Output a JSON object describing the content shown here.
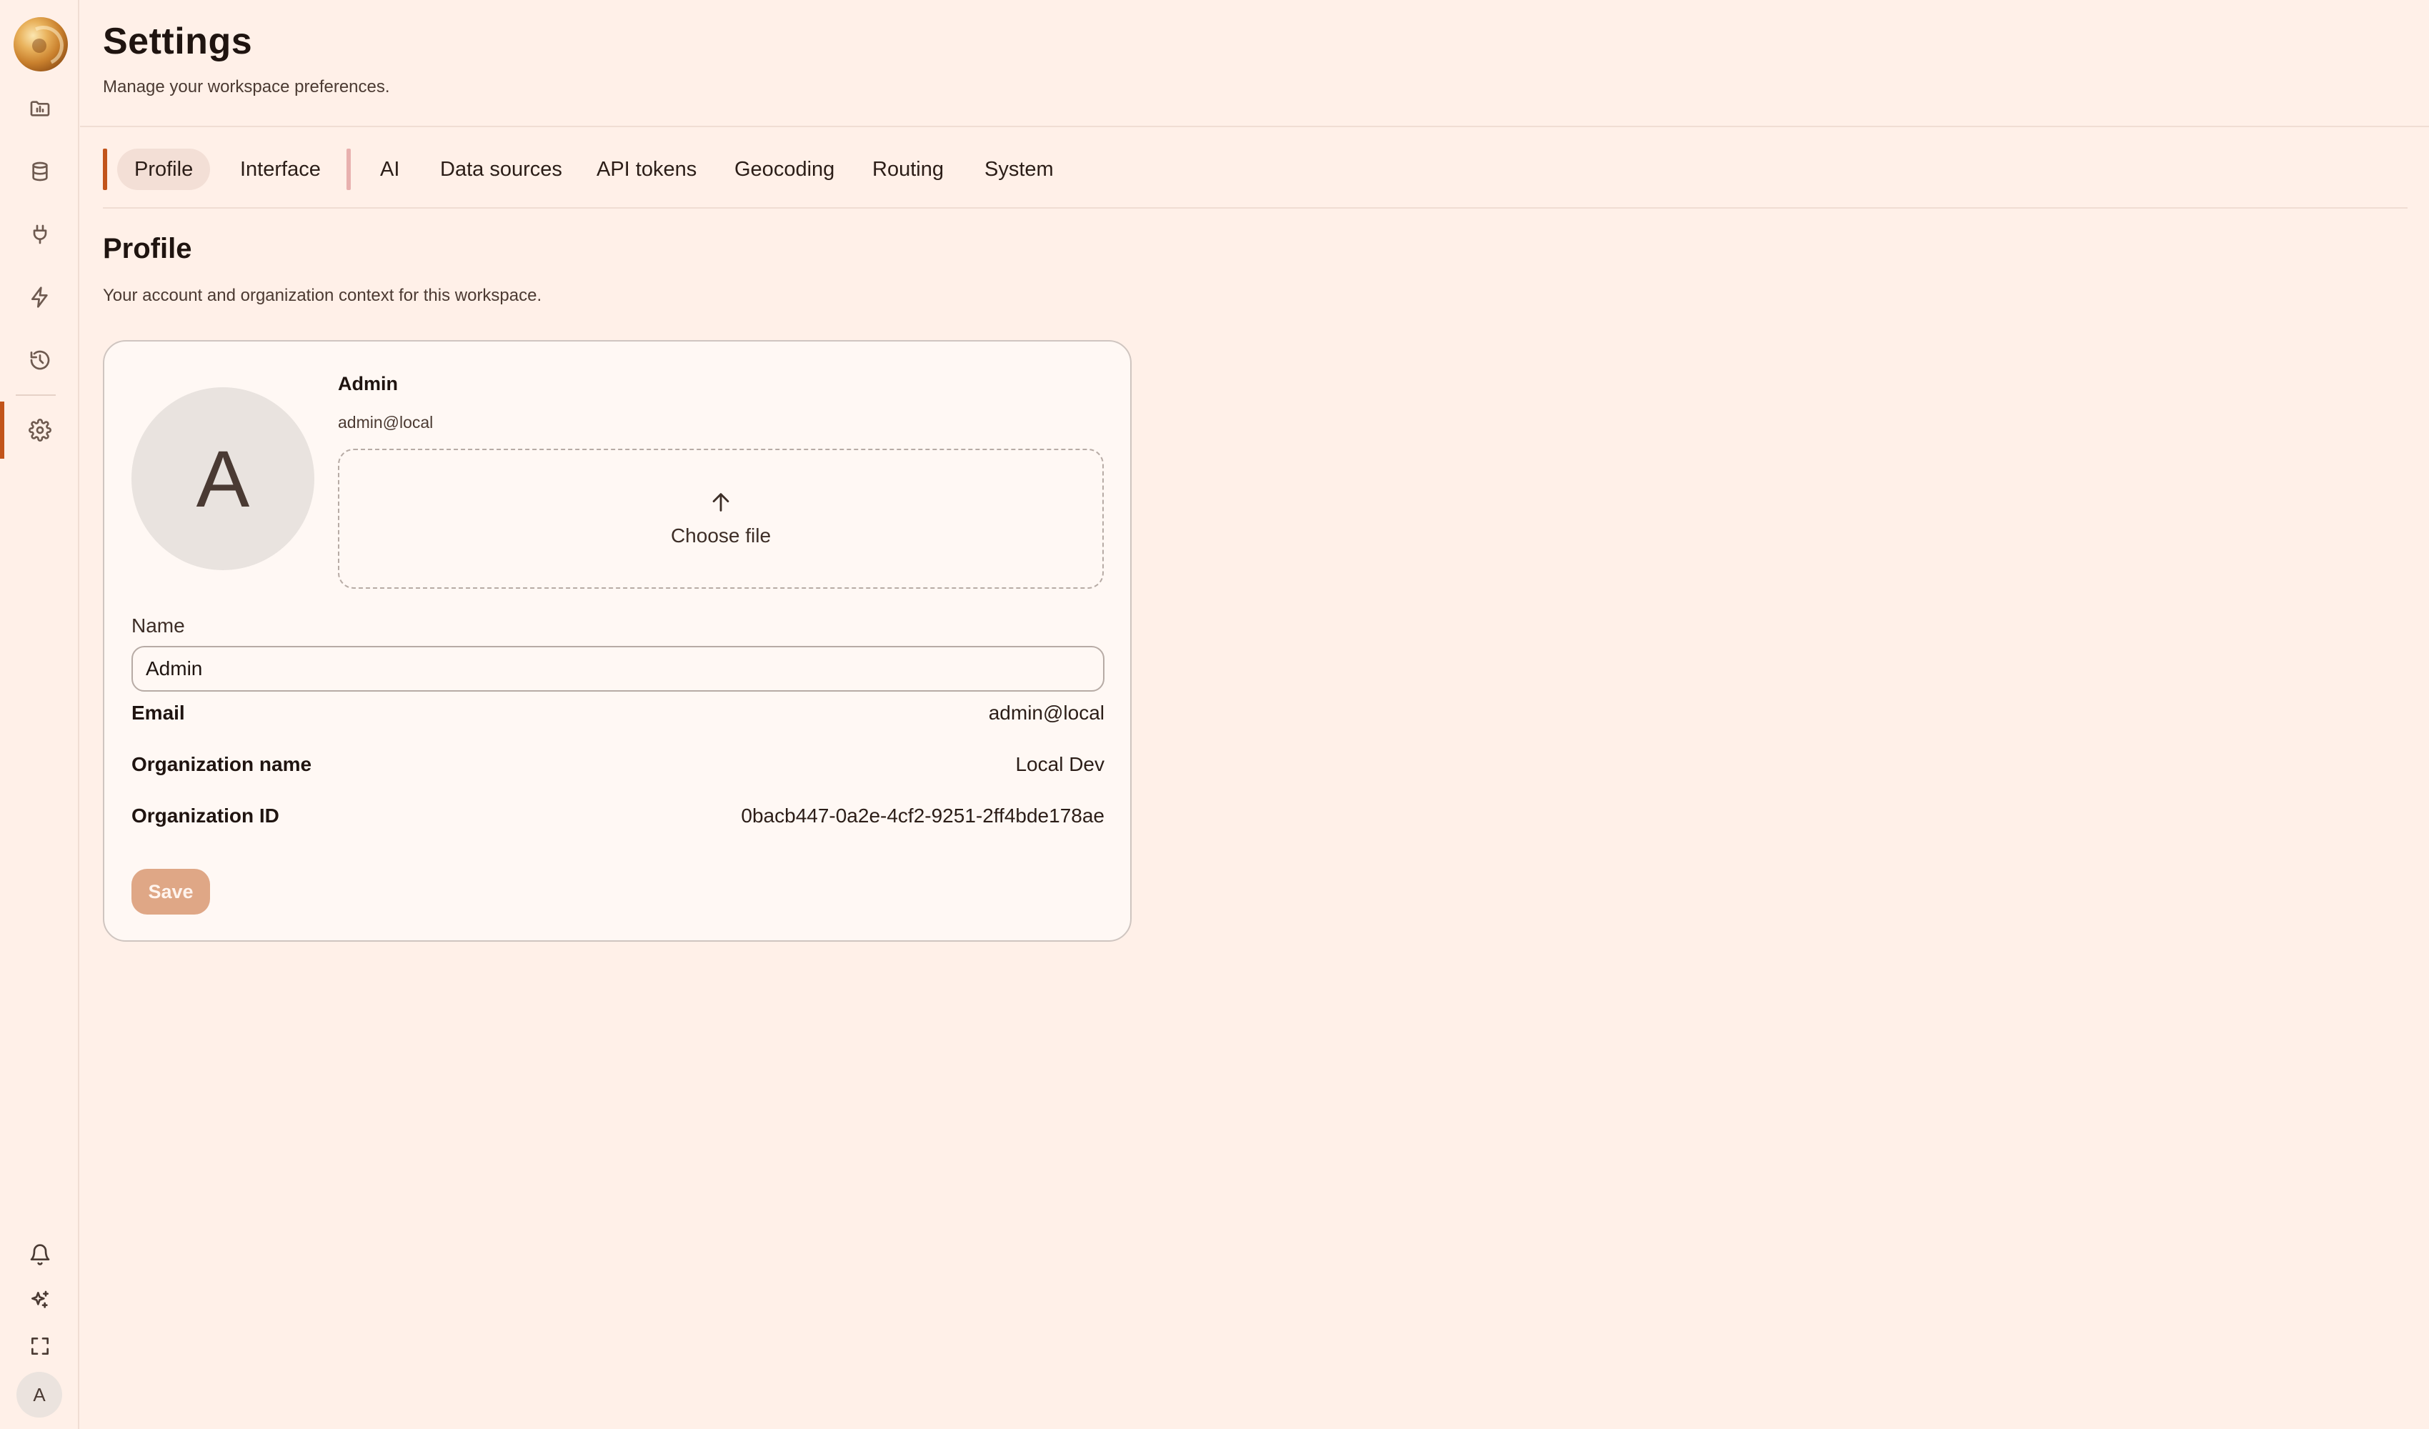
{
  "header": {
    "title": "Settings",
    "subtitle": "Manage your workspace preferences."
  },
  "sidebar": {
    "items": [
      {
        "icon": "folder-chart-icon",
        "active": false
      },
      {
        "icon": "database-icon",
        "active": false
      },
      {
        "icon": "plug-icon",
        "active": false
      },
      {
        "icon": "lightning-icon",
        "active": false
      },
      {
        "icon": "history-icon",
        "active": false
      },
      {
        "icon": "gear-icon",
        "active": true
      }
    ],
    "bottom": [
      "bell-icon",
      "sparkles-icon",
      "fullscreen-icon"
    ],
    "user_initial": "A"
  },
  "tabs": [
    {
      "label": "Profile",
      "active": true
    },
    {
      "label": "Interface",
      "active": false
    },
    {
      "label": "AI",
      "active": false
    },
    {
      "label": "Data sources",
      "active": false
    },
    {
      "label": "API tokens",
      "active": false
    },
    {
      "label": "Geocoding",
      "active": false
    },
    {
      "label": "Routing",
      "active": false
    },
    {
      "label": "System",
      "active": false
    }
  ],
  "section": {
    "title": "Profile",
    "description": "Your account and organization context for this workspace."
  },
  "profile": {
    "avatar_initial": "A",
    "display_name": "Admin",
    "email": "admin@local",
    "upload_label": "Choose file",
    "name_label": "Name",
    "name_value": "Admin",
    "fields": [
      {
        "label": "Email",
        "value": "admin@local"
      },
      {
        "label": "Organization name",
        "value": "Local Dev"
      },
      {
        "label": "Organization ID",
        "value": "0bacb447-0a2e-4cf2-9251-2ff4bde178ae"
      }
    ],
    "save_label": "Save"
  },
  "colors": {
    "background": "#fff0e8",
    "accent": "#c2541a",
    "save_button": "#dfa786"
  }
}
